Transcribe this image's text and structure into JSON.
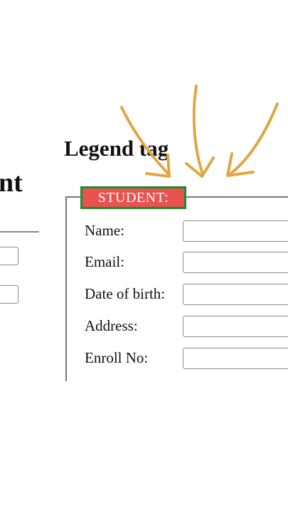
{
  "left_fragment": {
    "heading_partial": "nt"
  },
  "main": {
    "heading": "Legend tag"
  },
  "fieldset": {
    "legend": "STUDENT:",
    "legend_bg_color": "#e8524f",
    "legend_border_color": "#1f8a2f",
    "fields": [
      {
        "label": "Name:",
        "value": ""
      },
      {
        "label": "Email:",
        "value": ""
      },
      {
        "label": "Date of birth:",
        "value": ""
      },
      {
        "label": "Address:",
        "value": ""
      },
      {
        "label": "Enroll No:",
        "value": ""
      }
    ]
  },
  "annotation": {
    "arrow_color": "#e0a743",
    "arrow_count": 3
  }
}
